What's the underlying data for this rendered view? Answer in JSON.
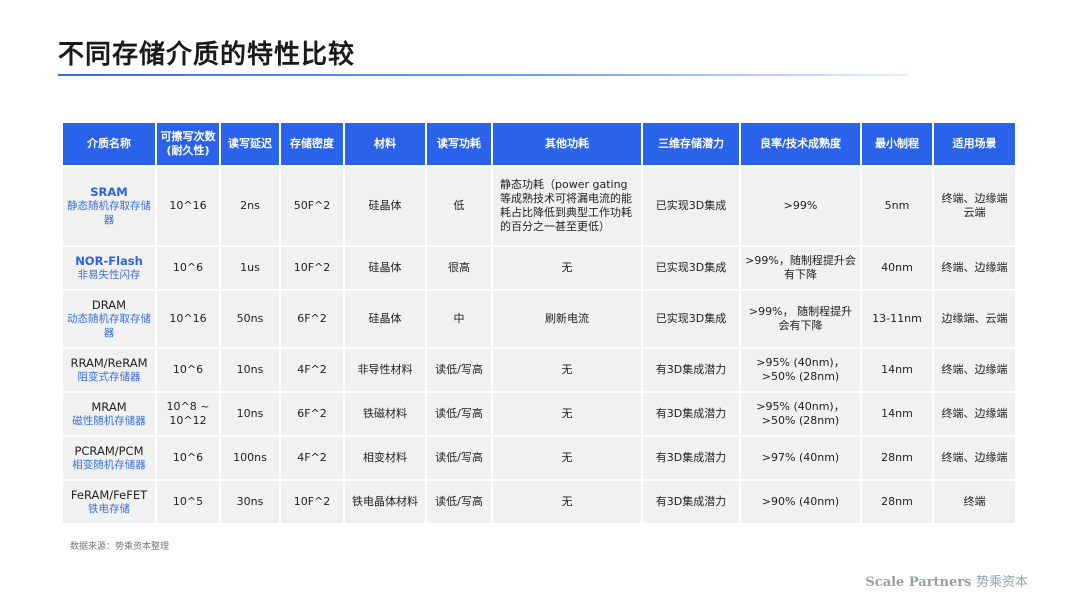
{
  "title": "不同存储介质的特性比较",
  "headers": [
    "介质名称",
    "可擦写次数\n(耐久性)",
    "读写延迟",
    "存储密度",
    "材料",
    "读写功耗",
    "其他功耗",
    "三维存储潜力",
    "良率/技术成熟度",
    "最小制程",
    "适用场景"
  ],
  "rows": [
    {
      "en": "SRAM",
      "zh": "静态随机存取存储器",
      "highlight": true,
      "cells": [
        "10^16",
        "2ns",
        "50F^2",
        "硅晶体",
        "低",
        "静态功耗（power gating等成熟技术可将漏电流的能耗占比降低到典型工作功耗的百分之一甚至更低）",
        "已实现3D集成",
        ">99%",
        "5nm",
        "终端、边缘端\n云端"
      ]
    },
    {
      "en": "NOR-Flash",
      "zh": "非易失性闪存",
      "highlight": true,
      "cells": [
        "10^6",
        "1us",
        "10F^2",
        "硅晶体",
        "很高",
        "无",
        "已实现3D集成",
        ">99%，随制程提升会有下降",
        "40nm",
        "终端、边缘端"
      ]
    },
    {
      "en": "DRAM",
      "zh": "动态随机存取存储器",
      "highlight": false,
      "cells": [
        "10^16",
        "50ns",
        "6F^2",
        "硅晶体",
        "中",
        "刷新电流",
        "已实现3D集成",
        ">99%， 随制程提升会有下降",
        "13-11nm",
        "边缘端、云端"
      ]
    },
    {
      "en": "RRAM/ReRAM",
      "zh": "阻变式存储器",
      "highlight": false,
      "cells": [
        "10^6",
        "10ns",
        "4F^2",
        "非导性材料",
        "读低/写高",
        "无",
        "有3D集成潜力",
        ">95% (40nm)，\n>50% (28nm)",
        "14nm",
        "终端、边缘端"
      ]
    },
    {
      "en": "MRAM",
      "zh": "磁性随机存储器",
      "highlight": false,
      "cells": [
        "10^8 ~\n10^12",
        "10ns",
        "6F^2",
        "铁磁材料",
        "读低/写高",
        "无",
        "有3D集成潜力",
        ">95% (40nm)，\n>50% (28nm)",
        "14nm",
        "终端、边缘端"
      ]
    },
    {
      "en": "PCRAM/PCM",
      "zh": "相变随机存储器",
      "highlight": false,
      "cells": [
        "10^6",
        "100ns",
        "4F^2",
        "相变材料",
        "读低/写高",
        "无",
        "有3D集成潜力",
        ">97% (40nm)",
        "28nm",
        "终端、边缘端"
      ]
    },
    {
      "en": "FeRAM/FeFET",
      "zh": "铁电存储",
      "highlight": false,
      "cells": [
        "10^5",
        "30ns",
        "10F^2",
        "铁电晶体材料",
        "读低/写高",
        "无",
        "有3D集成潜力",
        ">90% (40nm)",
        "28nm",
        "终端"
      ]
    }
  ],
  "source": "数据来源：势乘资本整理",
  "brand_en": "Scale Partners",
  "brand_cn": "势乘资本"
}
